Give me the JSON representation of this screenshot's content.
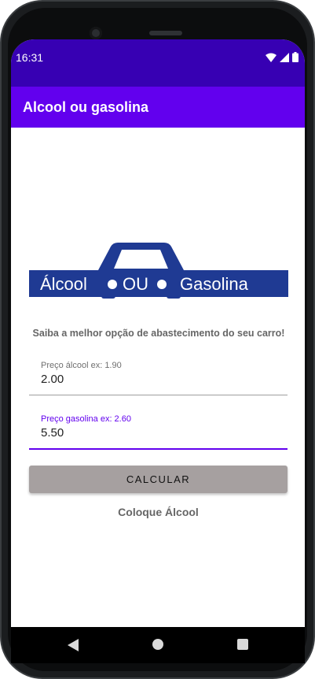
{
  "status_bar": {
    "time": "16:31"
  },
  "app_bar": {
    "title": "Alcool ou gasolina",
    "color": "#6200ee",
    "status_color": "#3700b3"
  },
  "logo": {
    "left_text": "Álcool",
    "middle_text": "OU",
    "right_text": "Gasolina",
    "color": "#1f3a93"
  },
  "tagline": "Saiba a melhor opção de abastecimento do seu carro!",
  "fields": {
    "alcool": {
      "label": "Preço álcool ex: 1.90",
      "value": "2.00"
    },
    "gasolina": {
      "label": "Preço gasolina ex: 2.60",
      "value": "5.50"
    }
  },
  "button": {
    "label": "CALCULAR"
  },
  "result": "Coloque Álcool",
  "nav": {
    "back_icon": "back-triangle-icon",
    "home_icon": "home-circle-icon",
    "recents_icon": "recents-square-icon"
  }
}
